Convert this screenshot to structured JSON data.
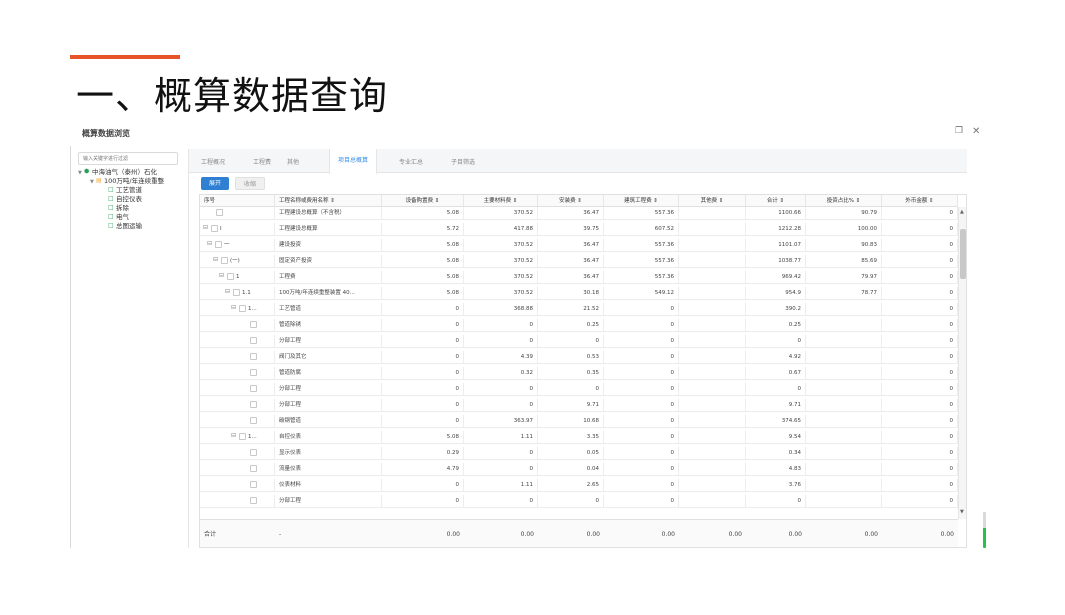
{
  "slide": {
    "title": "一、概算数据查询",
    "accent_color": "#e8532a"
  },
  "window": {
    "title": "概算数据浏览",
    "restore_icon": "restore-icon",
    "close_icon": "close-icon"
  },
  "tree": {
    "search_placeholder": "输入关键字进行过滤",
    "items": [
      {
        "label": "中海油气（泰州）石化",
        "icon": "org-icon"
      },
      {
        "label": "100万吨/年连续重整",
        "icon": "folder-icon"
      },
      {
        "label": "工艺管道",
        "icon": "file-icon"
      },
      {
        "label": "自控仪表",
        "icon": "file-icon"
      },
      {
        "label": "拆除",
        "icon": "file-icon"
      },
      {
        "label": "电气",
        "icon": "file-icon"
      },
      {
        "label": "总图运输",
        "icon": "file-icon"
      }
    ]
  },
  "tabs": [
    {
      "label": "工程概况"
    },
    {
      "label": "工程费"
    },
    {
      "label": "其他"
    },
    {
      "label": "项目总概算"
    },
    {
      "label": "专业汇总"
    },
    {
      "label": "子目筛选"
    }
  ],
  "actions": {
    "expand": "展开",
    "collapse": "收缩"
  },
  "grid": {
    "columns": [
      "序号",
      "工程名称或费用名称 ⇕",
      "设备购置费 ⇕",
      "主要材料费 ⇕",
      "安装费 ⇕",
      "建筑工程费 ⇕",
      "其他费 ⇕",
      "合计 ⇕",
      "投资占比% ⇕",
      "外币金额 ⇕"
    ],
    "rows": [
      {
        "code": "",
        "name": "工程建设总概算（不含税）",
        "equip": "5.08",
        "material": "370.52",
        "install": "36.47",
        "build": "557.36",
        "other": "",
        "total": "1100.66",
        "ratio": "90.79",
        "foreign": "0"
      },
      {
        "code": "Ⅰ",
        "name": "工程建设总概算",
        "equip": "5.72",
        "material": "417.88",
        "install": "39.75",
        "build": "607.52",
        "other": "",
        "total": "1212.28",
        "ratio": "100.00",
        "foreign": "0"
      },
      {
        "code": "一",
        "name": "建设投资",
        "equip": "5.08",
        "material": "370.52",
        "install": "36.47",
        "build": "557.36",
        "other": "",
        "total": "1101.07",
        "ratio": "90.83",
        "foreign": "0"
      },
      {
        "code": "(一)",
        "name": "固定资产投资",
        "equip": "5.08",
        "material": "370.52",
        "install": "36.47",
        "build": "557.36",
        "other": "",
        "total": "1038.77",
        "ratio": "85.69",
        "foreign": "0"
      },
      {
        "code": "1",
        "name": "工程费",
        "equip": "5.08",
        "material": "370.52",
        "install": "36.47",
        "build": "557.36",
        "other": "",
        "total": "969.42",
        "ratio": "79.97",
        "foreign": "0"
      },
      {
        "code": "1.1",
        "name": "100万吨/年连续重整装置 40...",
        "equip": "5.08",
        "material": "370.52",
        "install": "30.18",
        "build": "549.12",
        "other": "",
        "total": "954.9",
        "ratio": "78.77",
        "foreign": "0"
      },
      {
        "code": "1...",
        "name": "工艺管道",
        "equip": "0",
        "material": "368.88",
        "install": "21.52",
        "build": "0",
        "other": "",
        "total": "390.2",
        "ratio": "",
        "foreign": "0"
      },
      {
        "code": "",
        "name": "管道除锈",
        "equip": "0",
        "material": "0",
        "install": "0.25",
        "build": "0",
        "other": "",
        "total": "0.25",
        "ratio": "",
        "foreign": "0"
      },
      {
        "code": "",
        "name": "分部工程",
        "equip": "0",
        "material": "0",
        "install": "0",
        "build": "0",
        "other": "",
        "total": "0",
        "ratio": "",
        "foreign": "0"
      },
      {
        "code": "",
        "name": "阀门及其它",
        "equip": "0",
        "material": "4.39",
        "install": "0.53",
        "build": "0",
        "other": "",
        "total": "4.92",
        "ratio": "",
        "foreign": "0"
      },
      {
        "code": "",
        "name": "管道防腐",
        "equip": "0",
        "material": "0.32",
        "install": "0.35",
        "build": "0",
        "other": "",
        "total": "0.67",
        "ratio": "",
        "foreign": "0"
      },
      {
        "code": "",
        "name": "分部工程",
        "equip": "0",
        "material": "0",
        "install": "0",
        "build": "0",
        "other": "",
        "total": "0",
        "ratio": "",
        "foreign": "0"
      },
      {
        "code": "",
        "name": "分部工程",
        "equip": "0",
        "material": "0",
        "install": "9.71",
        "build": "0",
        "other": "",
        "total": "9.71",
        "ratio": "",
        "foreign": "0"
      },
      {
        "code": "",
        "name": "碳钢管道",
        "equip": "0",
        "material": "363.97",
        "install": "10.68",
        "build": "0",
        "other": "",
        "total": "374.65",
        "ratio": "",
        "foreign": "0"
      },
      {
        "code": "1...",
        "name": "自控仪表",
        "equip": "5.08",
        "material": "1.11",
        "install": "3.35",
        "build": "0",
        "other": "",
        "total": "9.54",
        "ratio": "",
        "foreign": "0"
      },
      {
        "code": "",
        "name": "显示仪表",
        "equip": "0.29",
        "material": "0",
        "install": "0.05",
        "build": "0",
        "other": "",
        "total": "0.34",
        "ratio": "",
        "foreign": "0"
      },
      {
        "code": "",
        "name": "流量仪表",
        "equip": "4.79",
        "material": "0",
        "install": "0.04",
        "build": "0",
        "other": "",
        "total": "4.83",
        "ratio": "",
        "foreign": "0"
      },
      {
        "code": "",
        "name": "仪表材料",
        "equip": "0",
        "material": "1.11",
        "install": "2.65",
        "build": "0",
        "other": "",
        "total": "3.76",
        "ratio": "",
        "foreign": "0"
      },
      {
        "code": "",
        "name": "分部工程",
        "equip": "0",
        "material": "0",
        "install": "0",
        "build": "0",
        "other": "",
        "total": "0",
        "ratio": "",
        "foreign": "0"
      }
    ],
    "footer": {
      "label": "合计",
      "name": "-",
      "equip": "0.00",
      "material": "0.00",
      "install": "0.00",
      "build": "0.00",
      "other": "0.00",
      "total": "0.00",
      "ratio": "0.00",
      "foreign": "0.00"
    }
  }
}
